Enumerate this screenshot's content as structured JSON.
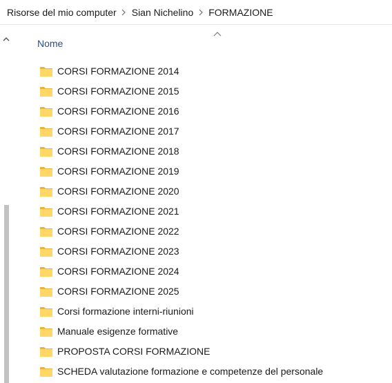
{
  "breadcrumb": {
    "items": [
      {
        "label": "Risorse del mio computer"
      },
      {
        "label": "Sian Nichelino"
      },
      {
        "label": "FORMAZIONE"
      }
    ]
  },
  "columns": {
    "name_header": "Nome",
    "sort": "ascending"
  },
  "files": [
    {
      "name": "CORSI FORMAZIONE 2014",
      "icon": "folder-icon"
    },
    {
      "name": "CORSI FORMAZIONE 2015",
      "icon": "folder-icon"
    },
    {
      "name": "CORSI FORMAZIONE 2016",
      "icon": "folder-icon"
    },
    {
      "name": "CORSI FORMAZIONE 2017",
      "icon": "folder-icon"
    },
    {
      "name": "CORSI FORMAZIONE 2018",
      "icon": "folder-icon"
    },
    {
      "name": "CORSI FORMAZIONE 2019",
      "icon": "folder-icon"
    },
    {
      "name": "CORSI FORMAZIONE 2020",
      "icon": "folder-icon"
    },
    {
      "name": "CORSI FORMAZIONE 2021",
      "icon": "folder-icon"
    },
    {
      "name": "CORSI FORMAZIONE 2022",
      "icon": "folder-icon"
    },
    {
      "name": "CORSI FORMAZIONE 2023",
      "icon": "folder-icon"
    },
    {
      "name": "CORSI FORMAZIONE 2024",
      "icon": "folder-icon"
    },
    {
      "name": "CORSI FORMAZIONE 2025",
      "icon": "folder-icon"
    },
    {
      "name": "Corsi formazione interni-riunioni",
      "icon": "folder-icon"
    },
    {
      "name": "Manuale esigenze formative",
      "icon": "folder-icon"
    },
    {
      "name": "PROPOSTA CORSI FORMAZIONE",
      "icon": "folder-icon"
    },
    {
      "name": "SCHEDA valutazione formazione e competenze del personale",
      "icon": "folder-icon"
    }
  ],
  "colors": {
    "folder_body": "#ffd766",
    "folder_tab": "#e8b53c",
    "header_text": "#2b4e8a",
    "scroll_thumb": "#c2c2c2"
  }
}
